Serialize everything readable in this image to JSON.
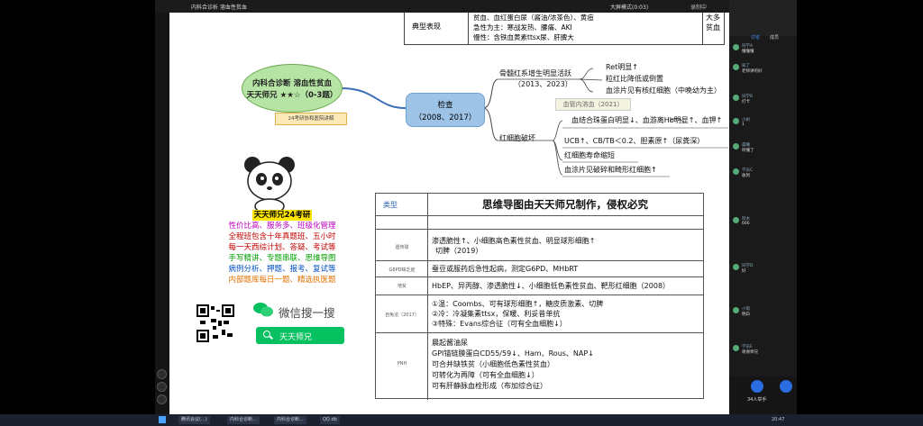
{
  "player": {
    "title": "内科合诊析 溶血性贫血",
    "center_text": "大屏模式(0:03)",
    "record_label": "录制中"
  },
  "top_table": {
    "label": "典型表现",
    "line1": "贫血、血红蛋白尿（酱油/浓茶色）、黄疸",
    "line2": "急性为主：寒战发热、腰痛、AKI",
    "line3": "慢性：含铁血黄素ttsx尿、肝脾大",
    "right_text": "大多\n贫血"
  },
  "title_bubble": {
    "line1": "内科合诊断 溶血性贫血",
    "line2": "天天师兄 ★★☆（0-3题）"
  },
  "caption_tag": "24考研协和医院讲解",
  "check_node": {
    "label": "检查",
    "years": "（2008、2017）"
  },
  "bone_marrow": {
    "label": "骨髓红系增生明显活跃",
    "years": "（2013、2023）",
    "items": [
      "Ret明显↑",
      "粒红比降低或倒置",
      "血涂片见有核红细胞（中晚幼为主）"
    ]
  },
  "rbc_destroy": {
    "label": "红细胞破坏",
    "tag": "血管内溶血（2021）",
    "items": [
      "血结合珠蛋白明显↓、血游离Hb明显↑、血钾↑",
      "UCB↑、CB/TB＜0.2、胆素原↑（尿粪深）",
      "红细胞寿命缩短",
      "血涂片见破碎和畸形红细胞↑"
    ]
  },
  "ad": {
    "head": "天天师兄24考研",
    "lines": [
      {
        "text": "性价比高、服务多、班级化管理",
        "color": "#c000c0"
      },
      {
        "text": "全程班包含十年真题班、五小时",
        "color": "#c00000"
      },
      {
        "text": "每一天西综计划、答疑、考试等",
        "color": "#c00000"
      },
      {
        "text": "手写精讲、专题串联、思维导图",
        "color": "#00a000"
      },
      {
        "text": "病例分析、押题、报考、复试等",
        "color": "#0050c0"
      },
      {
        "text": "内部题库每日一题、精选执医题",
        "color": "#e07000"
      }
    ]
  },
  "wechat": {
    "search_text": "微信搜一搜",
    "account": "天天师兄"
  },
  "table": {
    "header_key": "类型",
    "watermark": "思维导图由天天师兄制作，侵权必究",
    "rows": [
      {
        "cat": "",
        "lines": [
          ""
        ]
      },
      {
        "cat": "遗传球",
        "lines": [
          "渗透脆性↑、小细胞高色素性贫血、明显球形细胞↑",
          "切脾（2019）"
        ]
      },
      {
        "cat": "G6PD缺乏症",
        "lines": [
          "蚕豆或服药后急性起病，测定G6PD、MHbRT"
        ]
      },
      {
        "cat": "地贫",
        "lines": [
          "HbEP、异丙醇、渗透脆性↓、小细胞低色素性贫血、靶形红细胞（2008）"
        ]
      },
      {
        "cat": "自免溶（2017）",
        "lines": [
          "①温：Coombs、可有球形细胞↑，糖皮质激素、切脾",
          "②冷：冷凝集素ttsx，保暖、利妥昔单抗",
          "③特殊：Evans综合征（可有全血细胞↓）"
        ]
      },
      {
        "cat": "PNH",
        "lines": [
          "晨起酱油尿",
          "GPI锚链膜蛋白CD55/59↓、Ham、Rous、NAP↓",
          "可合并缺铁贫（小细胞低色素性贫血）",
          "可转化为再障（可有全血细胞↓）",
          "可有肝静脉血栓形成（布加综合征）"
        ]
      }
    ]
  },
  "chat": {
    "tabs": [
      "讨论",
      "成员"
    ],
    "count_label": "34人举手",
    "messages": [
      {
        "name": "同学A",
        "text": "懂懂懂"
      },
      {
        "name": "知了",
        "text": "老师讲的好"
      },
      {
        "name": "同学B",
        "text": "打卡"
      },
      {
        "name": "小树",
        "text": "1"
      },
      {
        "name": "晨曦",
        "text": "听懂了"
      },
      {
        "name": "学员C",
        "text": "收到"
      },
      {
        "name": "阿木",
        "text": "666"
      },
      {
        "name": "同学D",
        "text": "好"
      },
      {
        "name": "小雨",
        "text": "明白"
      },
      {
        "name": "学员E",
        "text": "谢谢师兄"
      }
    ]
  },
  "taskbar": {
    "apps": [
      "腾讯会议(...)",
      "内科合诊断...",
      "内科合诊断...",
      "QQ.db"
    ],
    "clock": "20:47"
  }
}
